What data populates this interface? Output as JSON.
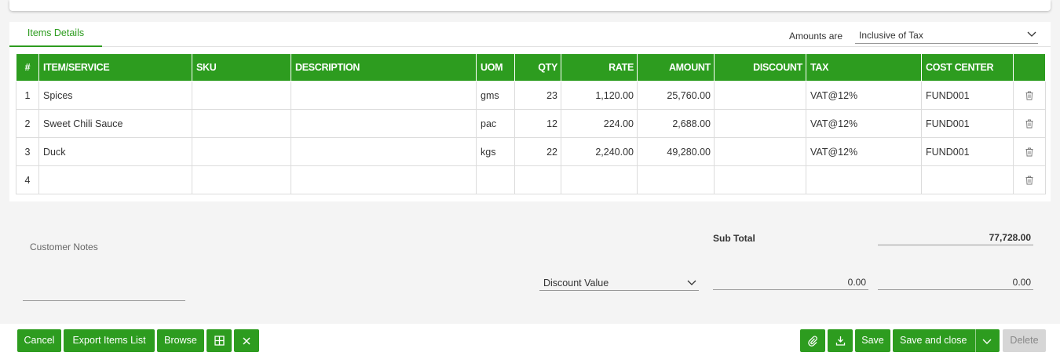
{
  "tabs": {
    "items_details": "Items Details"
  },
  "amounts": {
    "label": "Amounts are",
    "selected": "Inclusive of Tax"
  },
  "table": {
    "headers": [
      "#",
      "ITEM/SERVICE",
      "SKU",
      "DESCRIPTION",
      "UOM",
      "QTY",
      "RATE",
      "AMOUNT",
      "DISCOUNT",
      "TAX",
      "COST CENTER",
      ""
    ],
    "rows": [
      {
        "num": "1",
        "item": "Spices",
        "sku": "",
        "description": "",
        "uom": "gms",
        "qty": "23",
        "rate": "1,120.00",
        "amount": "25,760.00",
        "discount": "",
        "tax": "VAT@12%",
        "cost_center": "FUND001"
      },
      {
        "num": "2",
        "item": "Sweet Chili Sauce",
        "sku": "",
        "description": "",
        "uom": "pac",
        "qty": "12",
        "rate": "224.00",
        "amount": "2,688.00",
        "discount": "",
        "tax": "VAT@12%",
        "cost_center": "FUND001"
      },
      {
        "num": "3",
        "item": "Duck",
        "sku": "",
        "description": "",
        "uom": "kgs",
        "qty": "22",
        "rate": "2,240.00",
        "amount": "49,280.00",
        "discount": "",
        "tax": "VAT@12%",
        "cost_center": "FUND001"
      },
      {
        "num": "4",
        "item": "",
        "sku": "",
        "description": "",
        "uom": "",
        "qty": "",
        "rate": "",
        "amount": "",
        "discount": "",
        "tax": "",
        "cost_center": ""
      }
    ]
  },
  "notes": {
    "label": "Customer Notes"
  },
  "totals": {
    "subtotal_label": "Sub Total",
    "subtotal_value": "77,728.00",
    "discount_type": "Discount Value",
    "discount_input": "0.00",
    "discount_amount": "0.00"
  },
  "buttons": {
    "cancel": "Cancel",
    "export": "Export Items List",
    "browse": "Browse",
    "save": "Save",
    "save_close": "Save and close",
    "delete": "Delete"
  },
  "colors": {
    "accent": "#2d9c1f",
    "disabled": "#d6d6d6"
  },
  "icons": [
    "grid-icon",
    "close-icon",
    "paperclip-icon",
    "download-icon",
    "chevron-down-icon",
    "trash-icon"
  ]
}
